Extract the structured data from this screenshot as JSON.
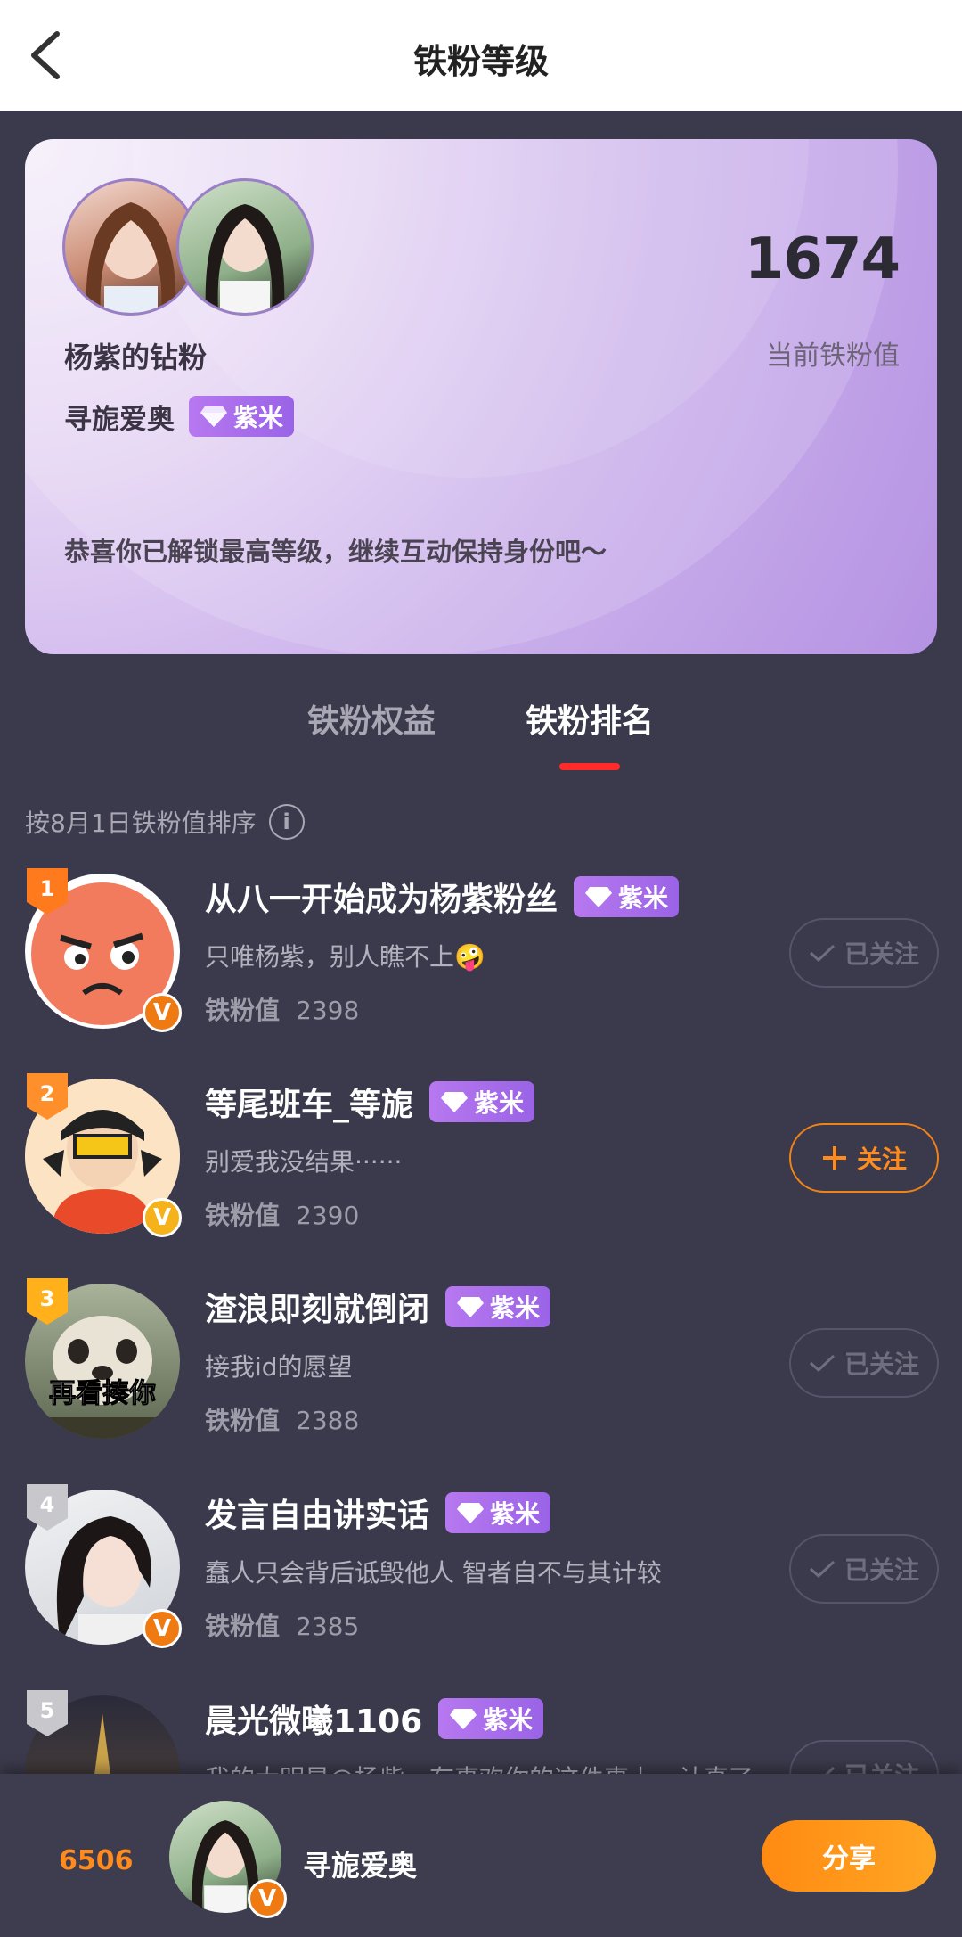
{
  "header": {
    "title": "铁粉等级"
  },
  "card": {
    "fan_title": "杨紫的钻粉",
    "username": "寻旎爱奥",
    "badge": "紫米",
    "score": "1674",
    "score_label": "当前铁粉值",
    "message": "恭喜你已解锁最高等级，继续互动保持身份吧～"
  },
  "tabs": [
    "铁粉权益",
    "铁粉排名"
  ],
  "sort_label": "按8月1日铁粉值排序",
  "fan_value_label": "铁粉值",
  "rows": [
    {
      "rank": "1",
      "name": "从八一开始成为杨紫粉丝",
      "badge": "紫米",
      "signature": "只唯杨紫，别人瞧不上🤪",
      "value": "2398",
      "button": "已关注"
    },
    {
      "rank": "2",
      "name": "等尾班车_等旎",
      "badge": "紫米",
      "signature": "别爱我没结果······",
      "value": "2390",
      "button": "关注"
    },
    {
      "rank": "3",
      "name": "渣浪即刻就倒闭",
      "badge": "紫米",
      "signature": "接我id的愿望",
      "value": "2388",
      "button": "已关注",
      "avatar_text": "再看揍你"
    },
    {
      "rank": "4",
      "name": "发言自由讲实话",
      "badge": "紫米",
      "signature": "蠢人只会背后诋毁他人 智者自不与其计较",
      "value": "2385",
      "button": "已关注"
    },
    {
      "rank": "5",
      "name": "晨光微曦1106",
      "badge": "紫米",
      "signature": "我的大明星@杨紫，有事欢你的这件事上，认真了",
      "value": "",
      "button": "已关注"
    }
  ],
  "bottom": {
    "score": "6506",
    "name": "寻旎爱奥",
    "share": "分享"
  },
  "colors": {
    "accent": "#ff8a1e",
    "tab_indicator": "#ff2a2a",
    "badge": "#a96bec",
    "bg": "#3b3a4c"
  }
}
